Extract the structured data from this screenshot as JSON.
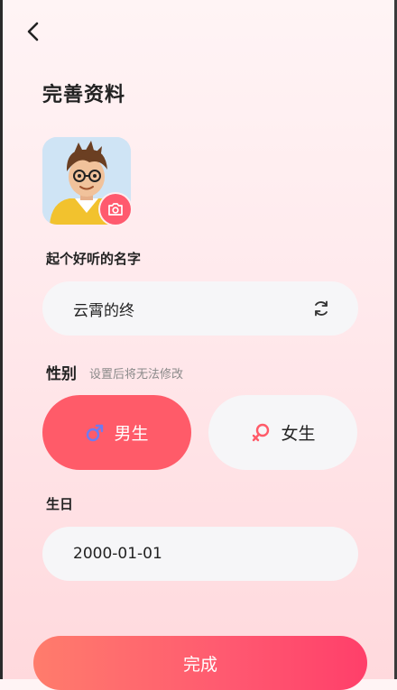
{
  "header": {
    "title": "完善资料"
  },
  "icons": {
    "back": "chevron-left-icon",
    "camera": "camera-icon",
    "refresh": "refresh-icon",
    "male": "male-symbol-icon",
    "female": "female-symbol-icon"
  },
  "name_section": {
    "label": "起个好听的名字",
    "value": "云霄的终"
  },
  "gender_section": {
    "label": "性别",
    "hint": "设置后将无法修改",
    "options": [
      {
        "label": "男生",
        "selected": true
      },
      {
        "label": "女生",
        "selected": false
      }
    ]
  },
  "birthday_section": {
    "label": "生日",
    "value": "2000-01-01"
  },
  "footer": {
    "done_label": "完成"
  },
  "colors": {
    "accent": "#ff5b69",
    "field_bg": "#f6f6f8",
    "male_icon": "#6f7bf0",
    "female_icon": "#ff5b69"
  }
}
